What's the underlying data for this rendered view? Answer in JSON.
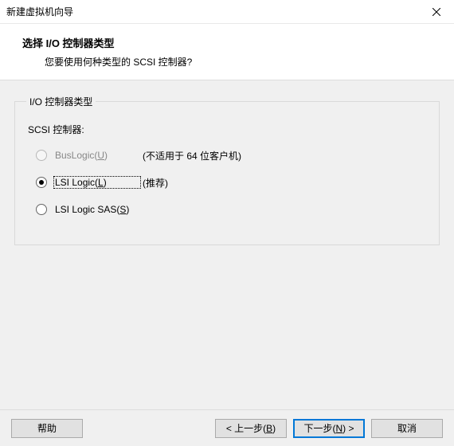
{
  "window": {
    "title": "新建虚拟机向导"
  },
  "header": {
    "title": "选择 I/O 控制器类型",
    "subtitle": "您要使用何种类型的 SCSI 控制器?"
  },
  "group": {
    "legend": "I/O 控制器类型",
    "section_label": "SCSI 控制器:",
    "options": [
      {
        "label_pre": "BusLogic(",
        "hotkey": "U",
        "label_post": ")",
        "note": "(不适用于 64 位客户机)",
        "checked": false,
        "disabled": true
      },
      {
        "label_pre": "LSI Logic(",
        "hotkey": "L",
        "label_post": ")",
        "note": "(推荐)",
        "checked": true,
        "disabled": false
      },
      {
        "label_pre": "LSI Logic SAS(",
        "hotkey": "S",
        "label_post": ")",
        "note": "",
        "checked": false,
        "disabled": false
      }
    ]
  },
  "buttons": {
    "help": "帮助",
    "back_pre": "< 上一步(",
    "back_hotkey": "B",
    "back_post": ")",
    "next_pre": "下一步(",
    "next_hotkey": "N",
    "next_post": ") >",
    "cancel": "取消"
  }
}
